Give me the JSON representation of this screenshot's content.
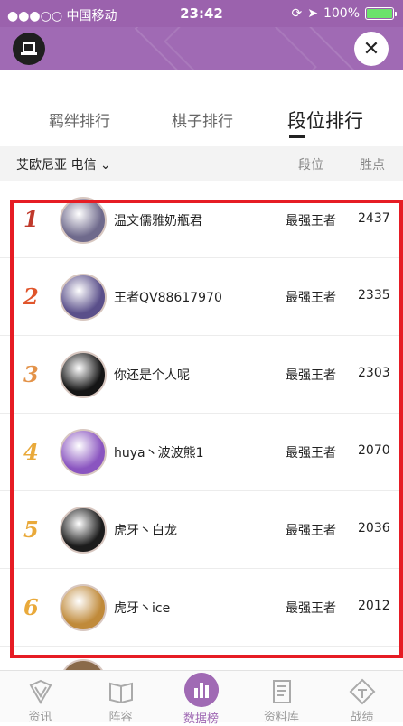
{
  "status_bar": {
    "carrier": "●●●○○ 中国移动",
    "time": "23:42",
    "battery": "100%",
    "battery_level": 1.0
  },
  "tabs": [
    {
      "label": "羁绊排行"
    },
    {
      "label": "棋子排行"
    },
    {
      "label": "段位排行"
    }
  ],
  "filter": {
    "region": "艾欧尼亚 电信",
    "col_rank": "段位",
    "col_points": "胜点"
  },
  "rows": [
    {
      "rank": "1",
      "name": "温文儒雅奶瓶君",
      "tier": "最强王者",
      "points": "2437",
      "color": "#c0392b",
      "avatar_color": "#6f6a8c"
    },
    {
      "rank": "2",
      "name": "王者QV88617970",
      "tier": "最强王者",
      "points": "2335",
      "color": "#e0552b",
      "avatar_color": "#5a4f8a"
    },
    {
      "rank": "3",
      "name": "你还是个人呢",
      "tier": "最强王者",
      "points": "2303",
      "color": "#e3934a",
      "avatar_color": "#151515"
    },
    {
      "rank": "4",
      "name": "huya丶波波熊1",
      "tier": "最强王者",
      "points": "2070",
      "color": "#e9a93a",
      "avatar_color": "#8a55c0"
    },
    {
      "rank": "5",
      "name": "虎牙丶白龙",
      "tier": "最强王者",
      "points": "2036",
      "color": "#e9a93a",
      "avatar_color": "#1c1c1c"
    },
    {
      "rank": "6",
      "name": "虎牙丶ice",
      "tier": "最强王者",
      "points": "2012",
      "color": "#e9a93a",
      "avatar_color": "#c08a3a"
    }
  ],
  "bottom_nav": [
    {
      "label": "资讯",
      "icon": "shield-icon"
    },
    {
      "label": "阵容",
      "icon": "book-icon"
    },
    {
      "label": "数据榜",
      "icon": "bar-chart-icon"
    },
    {
      "label": "资料库",
      "icon": "document-icon"
    },
    {
      "label": "战绩",
      "icon": "trophy-icon"
    }
  ],
  "colors": {
    "brand": "#a06ab4",
    "highlight_box": "#e61c24"
  }
}
